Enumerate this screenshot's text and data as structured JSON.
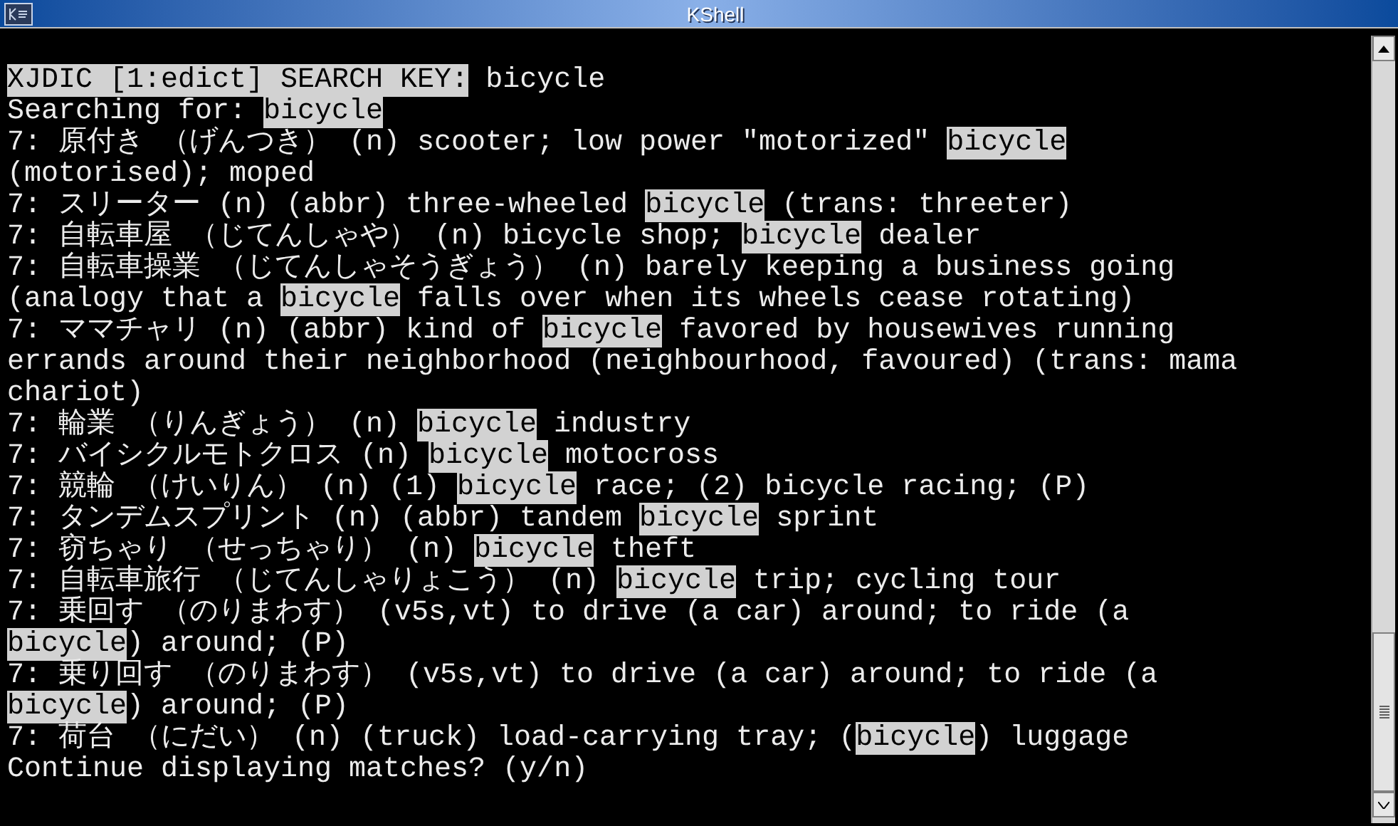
{
  "window": {
    "title": "KShell"
  },
  "terminal": {
    "lines": [
      {
        "segments": [
          {
            "text": "XJDIC [1:edict] SEARCH KEY:",
            "highlighted": true
          },
          {
            "text": " bicycle",
            "highlighted": false
          }
        ]
      },
      {
        "segments": [
          {
            "text": "Searching for: ",
            "highlighted": false
          },
          {
            "text": "bicycle",
            "highlighted": true
          }
        ]
      },
      {
        "segments": [
          {
            "text": "7: 原付き （げんつき） (n) scooter; low power \"motorized\" ",
            "highlighted": false
          },
          {
            "text": "bicycle",
            "highlighted": true
          }
        ]
      },
      {
        "segments": [
          {
            "text": "(motorised); moped",
            "highlighted": false
          }
        ]
      },
      {
        "segments": [
          {
            "text": "7: スリーター (n) (abbr) three-wheeled ",
            "highlighted": false
          },
          {
            "text": "bicycle",
            "highlighted": true
          },
          {
            "text": " (trans: threeter)",
            "highlighted": false
          }
        ]
      },
      {
        "segments": [
          {
            "text": "7: 自転車屋 （じてんしゃや） (n) bicycle shop; ",
            "highlighted": false
          },
          {
            "text": "bicycle",
            "highlighted": true
          },
          {
            "text": " dealer",
            "highlighted": false
          }
        ]
      },
      {
        "segments": [
          {
            "text": "7: 自転車操業 （じてんしゃそうぎょう） (n) barely keeping a business going",
            "highlighted": false
          }
        ]
      },
      {
        "segments": [
          {
            "text": "(analogy that a ",
            "highlighted": false
          },
          {
            "text": "bicycle",
            "highlighted": true
          },
          {
            "text": " falls over when its wheels cease rotating)",
            "highlighted": false
          }
        ]
      },
      {
        "segments": [
          {
            "text": "7: ママチャリ (n) (abbr) kind of ",
            "highlighted": false
          },
          {
            "text": "bicycle",
            "highlighted": true
          },
          {
            "text": " favored by housewives running",
            "highlighted": false
          }
        ]
      },
      {
        "segments": [
          {
            "text": "errands around their neighborhood (neighbourhood, favoured) (trans: mama",
            "highlighted": false
          }
        ]
      },
      {
        "segments": [
          {
            "text": "chariot)",
            "highlighted": false
          }
        ]
      },
      {
        "segments": [
          {
            "text": "7: 輪業 （りんぎょう） (n) ",
            "highlighted": false
          },
          {
            "text": "bicycle",
            "highlighted": true
          },
          {
            "text": " industry",
            "highlighted": false
          }
        ]
      },
      {
        "segments": [
          {
            "text": "7: バイシクルモトクロス (n) ",
            "highlighted": false
          },
          {
            "text": "bicycle",
            "highlighted": true
          },
          {
            "text": " motocross",
            "highlighted": false
          }
        ]
      },
      {
        "segments": [
          {
            "text": "7: 競輪 （けいりん） (n) (1) ",
            "highlighted": false
          },
          {
            "text": "bicycle",
            "highlighted": true
          },
          {
            "text": " race; (2) bicycle racing; (P)",
            "highlighted": false
          }
        ]
      },
      {
        "segments": [
          {
            "text": "7: タンデムスプリント (n) (abbr) tandem ",
            "highlighted": false
          },
          {
            "text": "bicycle",
            "highlighted": true
          },
          {
            "text": " sprint",
            "highlighted": false
          }
        ]
      },
      {
        "segments": [
          {
            "text": "7: 窃ちゃり （せっちゃり） (n) ",
            "highlighted": false
          },
          {
            "text": "bicycle",
            "highlighted": true
          },
          {
            "text": " theft",
            "highlighted": false
          }
        ]
      },
      {
        "segments": [
          {
            "text": "7: 自転車旅行 （じてんしゃりょこう） (n) ",
            "highlighted": false
          },
          {
            "text": "bicycle",
            "highlighted": true
          },
          {
            "text": " trip; cycling tour",
            "highlighted": false
          }
        ]
      },
      {
        "segments": [
          {
            "text": "7: 乗回す （のりまわす） (v5s,vt) to drive (a car) around; to ride (a",
            "highlighted": false
          }
        ]
      },
      {
        "segments": [
          {
            "text": "bicycle",
            "highlighted": true
          },
          {
            "text": ") around; (P)",
            "highlighted": false
          }
        ]
      },
      {
        "segments": [
          {
            "text": "7: 乗り回す （のりまわす） (v5s,vt) to drive (a car) around; to ride (a",
            "highlighted": false
          }
        ]
      },
      {
        "segments": [
          {
            "text": "bicycle",
            "highlighted": true
          },
          {
            "text": ") around; (P)",
            "highlighted": false
          }
        ]
      },
      {
        "segments": [
          {
            "text": "7: 荷台 （にだい） (n) (truck) load-carrying tray; (",
            "highlighted": false
          },
          {
            "text": "bicycle",
            "highlighted": true
          },
          {
            "text": ") luggage",
            "highlighted": false
          }
        ]
      },
      {
        "segments": [
          {
            "text": "Continue displaying matches? (y/n)",
            "highlighted": false
          }
        ]
      }
    ]
  }
}
